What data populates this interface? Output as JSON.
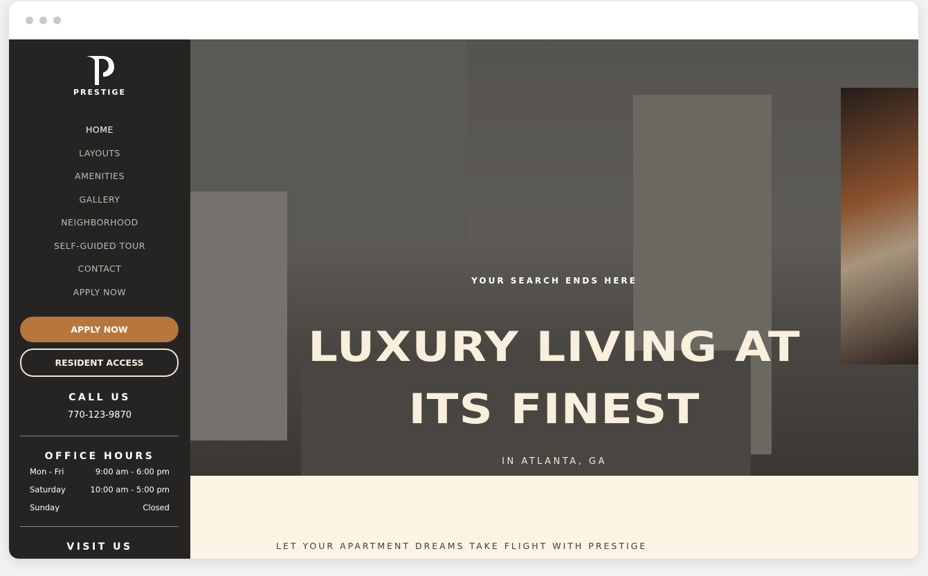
{
  "brand": {
    "name": "PRESTIGE"
  },
  "nav": {
    "items": [
      {
        "label": "HOME",
        "active": true
      },
      {
        "label": "LAYOUTS"
      },
      {
        "label": "AMENITIES"
      },
      {
        "label": "GALLERY"
      },
      {
        "label": "NEIGHBORHOOD"
      },
      {
        "label": "SELF-GUIDED TOUR"
      },
      {
        "label": "CONTACT"
      },
      {
        "label": "APPLY NOW"
      }
    ]
  },
  "buttons": {
    "apply": "APPLY NOW",
    "resident": "RESIDENT ACCESS"
  },
  "call": {
    "heading": "CALL US",
    "phone": "770-123-9870"
  },
  "hours": {
    "heading": "OFFICE HOURS",
    "rows": [
      {
        "day": "Mon - Fri",
        "time": "9:00 am - 6:00 pm"
      },
      {
        "day": "Saturday",
        "time": "10:00 am - 5:00 pm"
      },
      {
        "day": "Sunday",
        "time": "Closed"
      }
    ]
  },
  "visit": {
    "heading": "VISIT US"
  },
  "hero": {
    "kicker": "YOUR SEARCH ENDS HERE",
    "title_line1": "LUXURY LIVING AT",
    "title_line2": "ITS FINEST",
    "location": "IN ATLANTA, GA"
  },
  "intro": {
    "tagline": "LET YOUR APARTMENT DREAMS TAKE FLIGHT WITH PRESTIGE"
  },
  "colors": {
    "sidebar": "#262423",
    "accent": "#b7763b",
    "cream": "#fbf3e3"
  }
}
